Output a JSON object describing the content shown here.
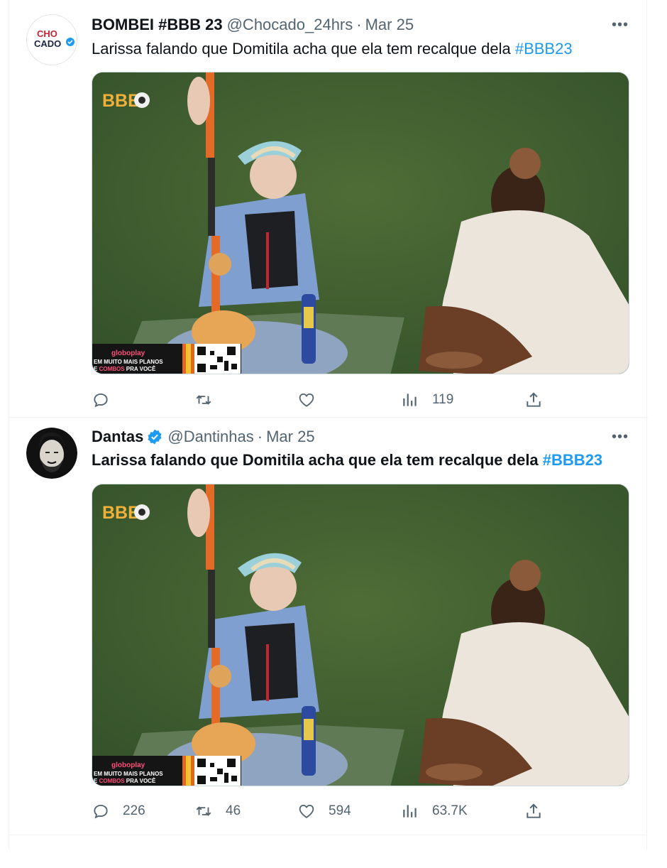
{
  "tweets": [
    {
      "display_name": "BOMBEI #BBB 23",
      "handle": "@Chocado_24hrs",
      "separator": "·",
      "date": "Mar 25",
      "avatar_text": {
        "line1": "CHO",
        "line2": "CADO"
      },
      "text": "Larissa falando que Domitila acha que ela tem recalque dela",
      "hashtag": "#BBB23",
      "media": {
        "logo": "BBB",
        "banner_brand": "globoplay",
        "banner_line1": "EM MUITO MAIS PLANOS",
        "banner_line2_pre": "E ",
        "banner_line2_accent": "COMBOS",
        "banner_line2_post": " PRA VOCÊ"
      },
      "stats": {
        "replies": "",
        "retweets": "",
        "likes": "",
        "views": "119"
      },
      "icons": [
        "reply-icon",
        "retweet-icon",
        "like-icon",
        "views-icon",
        "share-icon",
        "more-icon"
      ]
    },
    {
      "display_name": "Dantas",
      "verified": true,
      "handle": "@Dantinhas",
      "separator": "·",
      "date": "Mar 25",
      "text": "Larissa falando que Domitila acha que ela tem recalque dela",
      "hashtag": "#BBB23",
      "media": {
        "logo": "BBB",
        "banner_brand": "globoplay",
        "banner_line1": "EM MUITO MAIS PLANOS",
        "banner_line2_pre": "E ",
        "banner_line2_accent": "COMBOS",
        "banner_line2_post": " PRA VOCÊ"
      },
      "stats": {
        "replies": "226",
        "retweets": "46",
        "likes": "594",
        "views": "63.7K"
      },
      "icons": [
        "reply-icon",
        "retweet-icon",
        "like-icon",
        "views-icon",
        "share-icon",
        "more-icon"
      ]
    }
  ],
  "colors": {
    "accent": "#1d9bf0",
    "muted": "#536471",
    "text": "#0f1419",
    "border": "#eff3f4"
  }
}
